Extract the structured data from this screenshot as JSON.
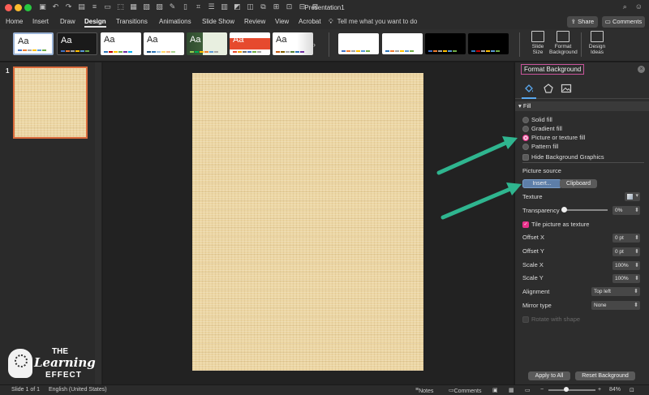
{
  "window": {
    "title": "Presentation1"
  },
  "tabs": [
    "Home",
    "Insert",
    "Draw",
    "Design",
    "Transitions",
    "Animations",
    "Slide Show",
    "Review",
    "View",
    "Acrobat"
  ],
  "active_tab": "Design",
  "tell_me": "Tell me what you want to do",
  "share_label": "Share",
  "comments_label": "Comments",
  "ribbon": {
    "theme_aa": "Aa",
    "slide_size": "Slide\nSize",
    "format_background": "Format\nBackground",
    "design_ideas": "Design\nIdeas"
  },
  "thumbnail": {
    "number": "1"
  },
  "format_pane": {
    "title": "Format Background",
    "section": "Fill",
    "fill_options": [
      {
        "label": "Solid fill",
        "selected": false
      },
      {
        "label": "Gradient fill",
        "selected": false
      },
      {
        "label": "Picture or texture fill",
        "selected": true
      },
      {
        "label": "Pattern fill",
        "selected": false
      }
    ],
    "hide_background_graphics": "Hide Background Graphics",
    "picture_source": "Picture source",
    "insert_label": "Insert...",
    "clipboard_label": "Clipboard",
    "texture_label": "Texture",
    "transparency_label": "Transparency",
    "transparency_value": "0%",
    "tile_label": "Tile picture as texture",
    "fields": [
      {
        "label": "Offset X",
        "value": "0 pt"
      },
      {
        "label": "Offset Y",
        "value": "0 pt"
      },
      {
        "label": "Scale X",
        "value": "100%"
      },
      {
        "label": "Scale Y",
        "value": "100%"
      }
    ],
    "alignment_label": "Alignment",
    "alignment_value": "Top left",
    "mirror_label": "Mirror type",
    "mirror_value": "None",
    "rotate_label": "Rotate with shape",
    "apply_all": "Apply to All",
    "reset": "Reset Background"
  },
  "logo": {
    "line1": "THE",
    "line2": "Learning",
    "line3": "EFFECT"
  },
  "status": {
    "slide": "Slide 1 of 1",
    "language": "English (United States)",
    "notes": "Notes",
    "comments": "Comments",
    "zoom": "84%"
  },
  "colors": {
    "accent": "#e8308a",
    "arrow": "#2fb58f",
    "slide": "#ecd6a3",
    "thumb_border": "#d96a3b"
  }
}
